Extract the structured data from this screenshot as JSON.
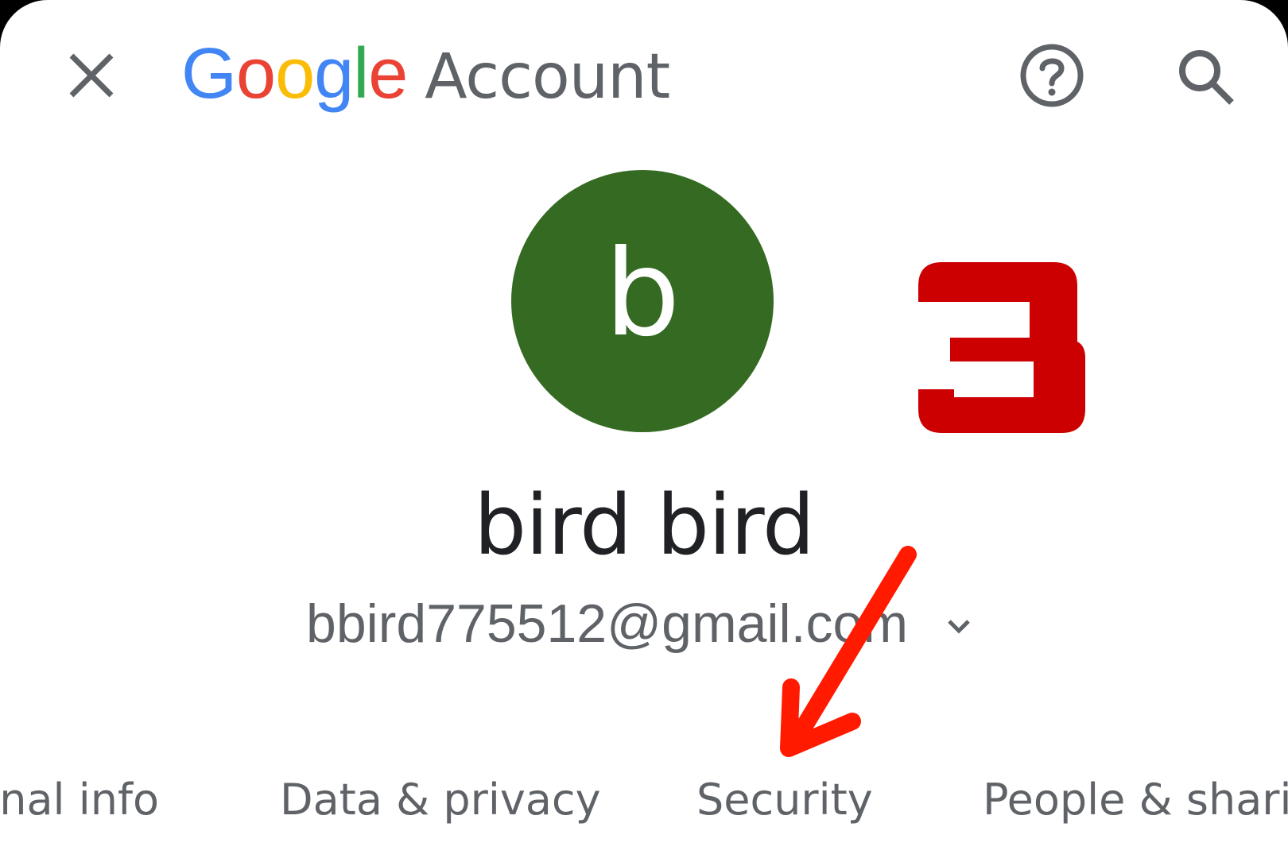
{
  "header": {
    "logo_letters": [
      {
        "char": "G",
        "color": "#4285F4"
      },
      {
        "char": "o",
        "color": "#EA4335"
      },
      {
        "char": "o",
        "color": "#FBBC05"
      },
      {
        "char": "g",
        "color": "#4285F4"
      },
      {
        "char": "l",
        "color": "#34A853"
      },
      {
        "char": "e",
        "color": "#EA4335"
      }
    ],
    "title_word": "Account",
    "icons": {
      "close": "close-icon",
      "help": "help-circle-icon",
      "search": "search-icon"
    }
  },
  "profile": {
    "avatar_letter": "b",
    "avatar_color": "#356a22",
    "name": "bird bird",
    "email": "bbird775512@gmail.com"
  },
  "annotation": {
    "step_number": "3",
    "step_color": "#cc0000",
    "arrow_color": "#ff1a00"
  },
  "tabs": [
    {
      "label": "Personal info"
    },
    {
      "label": "Data & privacy"
    },
    {
      "label": "Security"
    },
    {
      "label": "People & sharing"
    }
  ]
}
